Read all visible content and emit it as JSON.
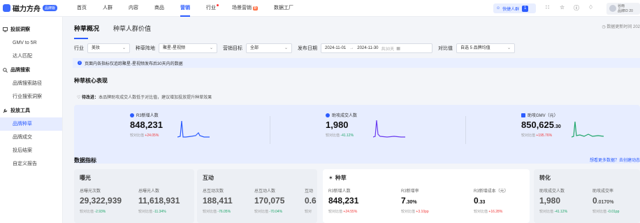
{
  "app": {
    "name": "磁力方舟",
    "badge": "品牌版"
  },
  "nav": [
    {
      "label": "首页"
    },
    {
      "label": "人群"
    },
    {
      "label": "内容"
    },
    {
      "label": "商品"
    },
    {
      "label": "营销",
      "active": true
    },
    {
      "label": "行业",
      "dot": true
    },
    {
      "label": "场景营销",
      "badge": "新"
    },
    {
      "label": "数据工厂"
    }
  ],
  "topbar": {
    "quick_label": "快捷人群",
    "quick_count": "1",
    "user_name": "谷雨",
    "user_sub": "品牌ID 20"
  },
  "sidebar": [
    {
      "group": "投前洞察",
      "icon": "monitor-icon",
      "items": [
        "GMV to 5R",
        "达人匹配"
      ]
    },
    {
      "group": "品牌搜索",
      "icon": "search-icon",
      "items": [
        "品牌搜索路径",
        "行业搜索洞察"
      ]
    },
    {
      "group": "投放工具",
      "icon": "wrench-icon",
      "items": [
        "品牌种草",
        "品牌成交",
        "投后结案",
        "自定义报告"
      ],
      "active": "品牌种草"
    }
  ],
  "tabs": [
    {
      "label": "种草概况",
      "active": true
    },
    {
      "label": "种草人群价值"
    }
  ],
  "update_text": "数据更新时间 202",
  "filters": {
    "industry_label": "行业",
    "industry_value": "美妆",
    "position_label": "种草阵地",
    "position_value": "聚星-星视频",
    "goal_label": "营销目标",
    "goal_value": "全部",
    "date_label": "发布日期",
    "date_start": "2024-11-01",
    "date_sep": "→",
    "date_end": "2024-11-30",
    "date_days": "共30天",
    "compare_label": "对比值",
    "compare_value": "自选 5 品牌均值"
  },
  "notice": "页面内各指标仅追踪聚星-星视频发布后30天内的数据",
  "core_title": "种草核心表现",
  "tip": {
    "prefix": "待改进：",
    "body": "本品牌助攻成交人数低于对比值，建议增加投放提升种草效果",
    "bold": "助攻成交人数"
  },
  "kpis": [
    {
      "label": "R3新增人数",
      "value": "848,231",
      "decimal": "",
      "comp_label": "较对比值",
      "comp": "+24.05%",
      "trend": "up",
      "line_color": "#2c5cff"
    },
    {
      "label": "助攻成交人数",
      "value": "1,980",
      "decimal": "",
      "comp_label": "较对比值",
      "comp": "-41.12%",
      "trend": "down",
      "line_color": "#6a3cf0"
    },
    {
      "label": "助攻GMV（元）",
      "value": "850,625",
      "decimal": ".30",
      "comp_label": "较对比值",
      "comp": "+195.76%",
      "trend": "up",
      "line_color": "#1fa66a"
    }
  ],
  "metrics_title": "数据指标",
  "more_link": "想看更多数据？去创建动态",
  "cards": {
    "exposure": {
      "title": "曝光",
      "metrics": [
        {
          "label": "总曝光次数",
          "value": "29,322,939",
          "comp_label": "较对比值",
          "comp": "-2.93%",
          "trend": "down"
        },
        {
          "label": "总曝光人数",
          "value": "11,618,931",
          "comp_label": "较对比值",
          "comp": "-11.34%",
          "trend": "down"
        }
      ]
    },
    "interact": {
      "title": "互动",
      "metrics": [
        {
          "label": "总互动次数",
          "value": "188,411",
          "comp_label": "较对比值",
          "comp": "-76.05%",
          "trend": "down"
        },
        {
          "label": "总互动人数",
          "value": "170,075",
          "comp_label": "较对比值",
          "comp": "-70.04%",
          "trend": "down"
        },
        {
          "label": "互动",
          "value": "0.6",
          "comp_label": "较对",
          "comp": "",
          "trend": "down"
        }
      ]
    },
    "grass": {
      "title": "种草",
      "metrics": [
        {
          "label": "R3新增人数",
          "value": "848,231",
          "comp_label": "较对比值",
          "comp": "+24.55%",
          "trend": "up"
        },
        {
          "label": "R3新增率",
          "value": "7",
          "decimal": ".30%",
          "comp_label": "较对比值",
          "comp": "+3.10pp",
          "trend": "up"
        },
        {
          "label": "R3新增成本（元）",
          "value": "0",
          "decimal": ".33",
          "comp_label": "较对比值",
          "comp": "+16.28%",
          "trend": "up"
        }
      ]
    },
    "convert": {
      "title": "转化",
      "metrics": [
        {
          "label": "助攻成交人数",
          "value": "1,980",
          "comp_label": "较对比值",
          "comp": "-41.12%",
          "trend": "down"
        },
        {
          "label": "助攻成交率",
          "value": "0",
          "decimal": ".0170%",
          "comp_label": "较对比值",
          "comp": "-0.01pp",
          "trend": "down"
        }
      ]
    }
  }
}
